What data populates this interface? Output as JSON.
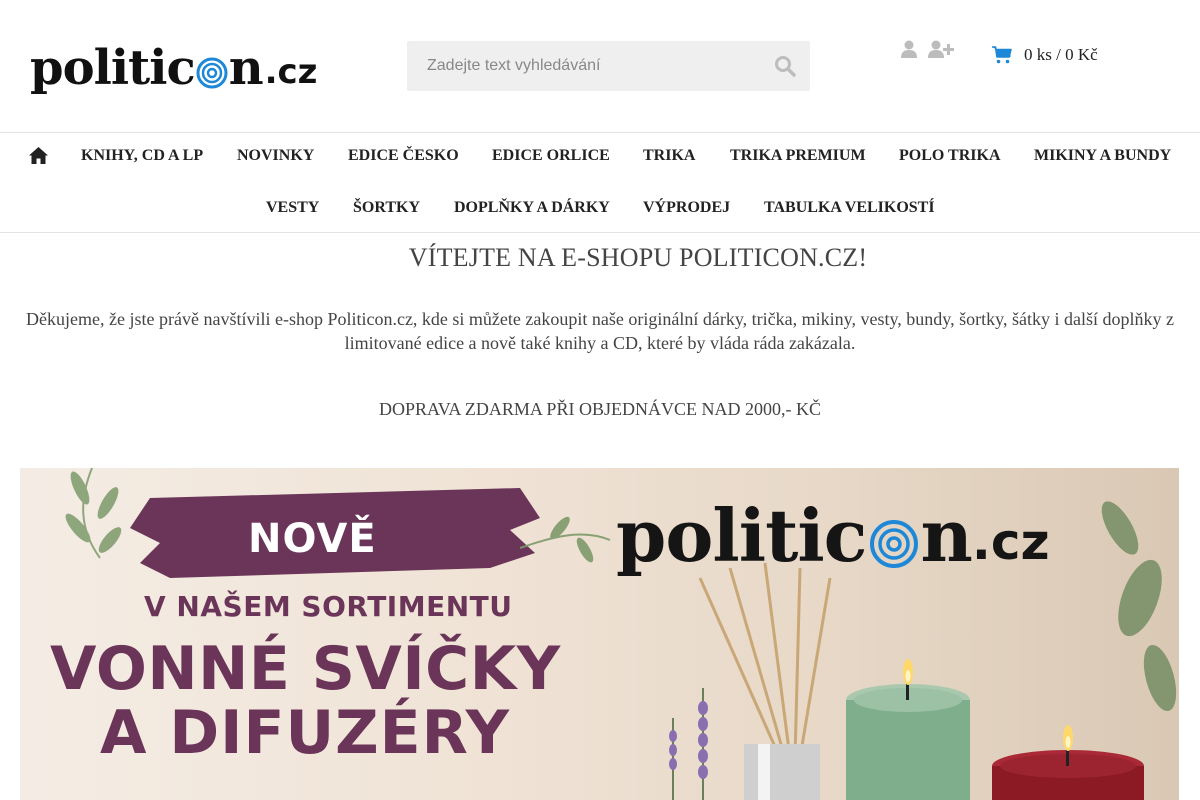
{
  "header": {
    "logo": {
      "main_a": "politic",
      "main_b": "n",
      "tld": ".cz"
    },
    "search": {
      "placeholder": "Zadejte text vyhledávání",
      "icon": "search-icon"
    },
    "account": {
      "user_icon": "user-icon",
      "register_icon": "user-plus-icon"
    },
    "cart": {
      "icon": "cart-icon",
      "text": "0 ks / 0 Kč"
    }
  },
  "nav": {
    "home_icon": "home-icon",
    "row1": [
      "KNIHY, CD A LP",
      "NOVINKY",
      "EDICE ČESKO",
      "EDICE ORLICE",
      "TRIKA",
      "TRIKA PREMIUM",
      "POLO TRIKA",
      "MIKINY A BUNDY"
    ],
    "row2": [
      "VESTY",
      "ŠORTKY",
      "DOPLŇKY A DÁRKY",
      "VÝPRODEJ",
      "TABULKA VELIKOSTÍ"
    ]
  },
  "content": {
    "title": "VÍTEJTE NA E-SHOPU POLITICON.CZ!",
    "intro": "Děkujeme, že jste právě navštívili e-shop Politicon.cz, kde si můžete zakoupit naše originální dárky, trička, mikiny, vesty, bundy, šortky, šátky i další doplňky z limitované edice a nově také knihy a CD, které by vláda ráda zakázala.",
    "shipping": "DOPRAVA ZDARMA PŘI OBJEDNÁVCE NAD 2000,- KČ"
  },
  "banner": {
    "badge": "NOVĚ",
    "subtitle": "V NAŠEM SORTIMENTU",
    "line1": "VONNÉ SVÍČKY",
    "line2": "A DIFUZÉRY",
    "logo": {
      "main_a": "politic",
      "main_b": "n",
      "tld": ".cz"
    },
    "colors": {
      "purple": "#6a3558",
      "candle_green": "#7fae8c",
      "candle_red": "#8b1a24"
    }
  },
  "colors": {
    "accent_blue": "#1e88d8",
    "icon_grey": "#bcbcbc"
  }
}
